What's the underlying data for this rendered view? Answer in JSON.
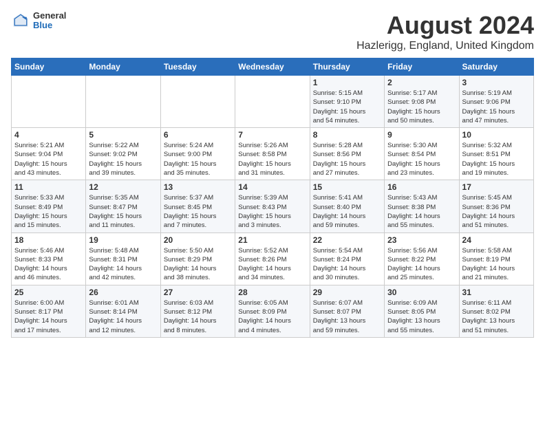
{
  "header": {
    "logo_general": "General",
    "logo_blue": "Blue",
    "main_title": "August 2024",
    "subtitle": "Hazlerigg, England, United Kingdom"
  },
  "weekdays": [
    "Sunday",
    "Monday",
    "Tuesday",
    "Wednesday",
    "Thursday",
    "Friday",
    "Saturday"
  ],
  "weeks": [
    [
      {
        "day": "",
        "info": ""
      },
      {
        "day": "",
        "info": ""
      },
      {
        "day": "",
        "info": ""
      },
      {
        "day": "",
        "info": ""
      },
      {
        "day": "1",
        "info": "Sunrise: 5:15 AM\nSunset: 9:10 PM\nDaylight: 15 hours\nand 54 minutes."
      },
      {
        "day": "2",
        "info": "Sunrise: 5:17 AM\nSunset: 9:08 PM\nDaylight: 15 hours\nand 50 minutes."
      },
      {
        "day": "3",
        "info": "Sunrise: 5:19 AM\nSunset: 9:06 PM\nDaylight: 15 hours\nand 47 minutes."
      }
    ],
    [
      {
        "day": "4",
        "info": "Sunrise: 5:21 AM\nSunset: 9:04 PM\nDaylight: 15 hours\nand 43 minutes."
      },
      {
        "day": "5",
        "info": "Sunrise: 5:22 AM\nSunset: 9:02 PM\nDaylight: 15 hours\nand 39 minutes."
      },
      {
        "day": "6",
        "info": "Sunrise: 5:24 AM\nSunset: 9:00 PM\nDaylight: 15 hours\nand 35 minutes."
      },
      {
        "day": "7",
        "info": "Sunrise: 5:26 AM\nSunset: 8:58 PM\nDaylight: 15 hours\nand 31 minutes."
      },
      {
        "day": "8",
        "info": "Sunrise: 5:28 AM\nSunset: 8:56 PM\nDaylight: 15 hours\nand 27 minutes."
      },
      {
        "day": "9",
        "info": "Sunrise: 5:30 AM\nSunset: 8:54 PM\nDaylight: 15 hours\nand 23 minutes."
      },
      {
        "day": "10",
        "info": "Sunrise: 5:32 AM\nSunset: 8:51 PM\nDaylight: 15 hours\nand 19 minutes."
      }
    ],
    [
      {
        "day": "11",
        "info": "Sunrise: 5:33 AM\nSunset: 8:49 PM\nDaylight: 15 hours\nand 15 minutes."
      },
      {
        "day": "12",
        "info": "Sunrise: 5:35 AM\nSunset: 8:47 PM\nDaylight: 15 hours\nand 11 minutes."
      },
      {
        "day": "13",
        "info": "Sunrise: 5:37 AM\nSunset: 8:45 PM\nDaylight: 15 hours\nand 7 minutes."
      },
      {
        "day": "14",
        "info": "Sunrise: 5:39 AM\nSunset: 8:43 PM\nDaylight: 15 hours\nand 3 minutes."
      },
      {
        "day": "15",
        "info": "Sunrise: 5:41 AM\nSunset: 8:40 PM\nDaylight: 14 hours\nand 59 minutes."
      },
      {
        "day": "16",
        "info": "Sunrise: 5:43 AM\nSunset: 8:38 PM\nDaylight: 14 hours\nand 55 minutes."
      },
      {
        "day": "17",
        "info": "Sunrise: 5:45 AM\nSunset: 8:36 PM\nDaylight: 14 hours\nand 51 minutes."
      }
    ],
    [
      {
        "day": "18",
        "info": "Sunrise: 5:46 AM\nSunset: 8:33 PM\nDaylight: 14 hours\nand 46 minutes."
      },
      {
        "day": "19",
        "info": "Sunrise: 5:48 AM\nSunset: 8:31 PM\nDaylight: 14 hours\nand 42 minutes."
      },
      {
        "day": "20",
        "info": "Sunrise: 5:50 AM\nSunset: 8:29 PM\nDaylight: 14 hours\nand 38 minutes."
      },
      {
        "day": "21",
        "info": "Sunrise: 5:52 AM\nSunset: 8:26 PM\nDaylight: 14 hours\nand 34 minutes."
      },
      {
        "day": "22",
        "info": "Sunrise: 5:54 AM\nSunset: 8:24 PM\nDaylight: 14 hours\nand 30 minutes."
      },
      {
        "day": "23",
        "info": "Sunrise: 5:56 AM\nSunset: 8:22 PM\nDaylight: 14 hours\nand 25 minutes."
      },
      {
        "day": "24",
        "info": "Sunrise: 5:58 AM\nSunset: 8:19 PM\nDaylight: 14 hours\nand 21 minutes."
      }
    ],
    [
      {
        "day": "25",
        "info": "Sunrise: 6:00 AM\nSunset: 8:17 PM\nDaylight: 14 hours\nand 17 minutes."
      },
      {
        "day": "26",
        "info": "Sunrise: 6:01 AM\nSunset: 8:14 PM\nDaylight: 14 hours\nand 12 minutes."
      },
      {
        "day": "27",
        "info": "Sunrise: 6:03 AM\nSunset: 8:12 PM\nDaylight: 14 hours\nand 8 minutes."
      },
      {
        "day": "28",
        "info": "Sunrise: 6:05 AM\nSunset: 8:09 PM\nDaylight: 14 hours\nand 4 minutes."
      },
      {
        "day": "29",
        "info": "Sunrise: 6:07 AM\nSunset: 8:07 PM\nDaylight: 13 hours\nand 59 minutes."
      },
      {
        "day": "30",
        "info": "Sunrise: 6:09 AM\nSunset: 8:05 PM\nDaylight: 13 hours\nand 55 minutes."
      },
      {
        "day": "31",
        "info": "Sunrise: 6:11 AM\nSunset: 8:02 PM\nDaylight: 13 hours\nand 51 minutes."
      }
    ]
  ]
}
